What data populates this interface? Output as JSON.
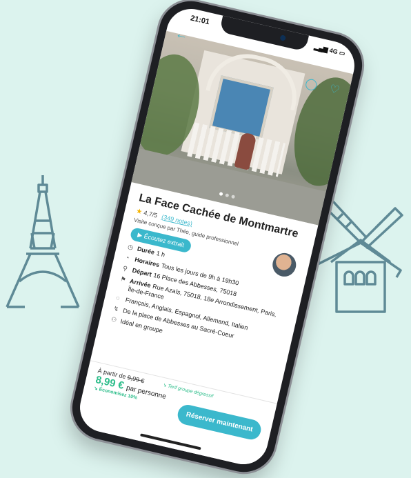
{
  "status": {
    "time": "21:01",
    "network": "4G"
  },
  "tour": {
    "title": "La Face Cachée de Montmartre",
    "rating": "4,7/5",
    "notes_link": "(349 notes)",
    "guide_line": "Visite conçue par Théo, guide professionnel",
    "listen_button": "Écoutez extrait"
  },
  "details": {
    "duration_label": "Durée",
    "duration_value": "1 h",
    "hours_label": "Horaires",
    "hours_value": "Tous les jours de 9h à 19h30",
    "departure_label": "Départ",
    "departure_value": "16 Place des Abbesses, 75018",
    "arrival_label": "Arrivée",
    "arrival_value": "Rue Azaïs, 75018, 18e Arrondissement, Paris, Île-de-France",
    "languages": "Français, Anglais, Espagnol, Allemand, Italien",
    "route": "De la place de Abbesses au Sacré-Coeur",
    "group": "Idéal en groupe"
  },
  "pricing": {
    "from_label": "À partir de",
    "old_price": "9,99 €",
    "tarif_note": "↘ Tarif groupe dégressif",
    "price": "8,99 €",
    "per_person": "par personne",
    "savings": "↘ Économisez 10%",
    "reserve_button": "Réserver maintenant"
  }
}
